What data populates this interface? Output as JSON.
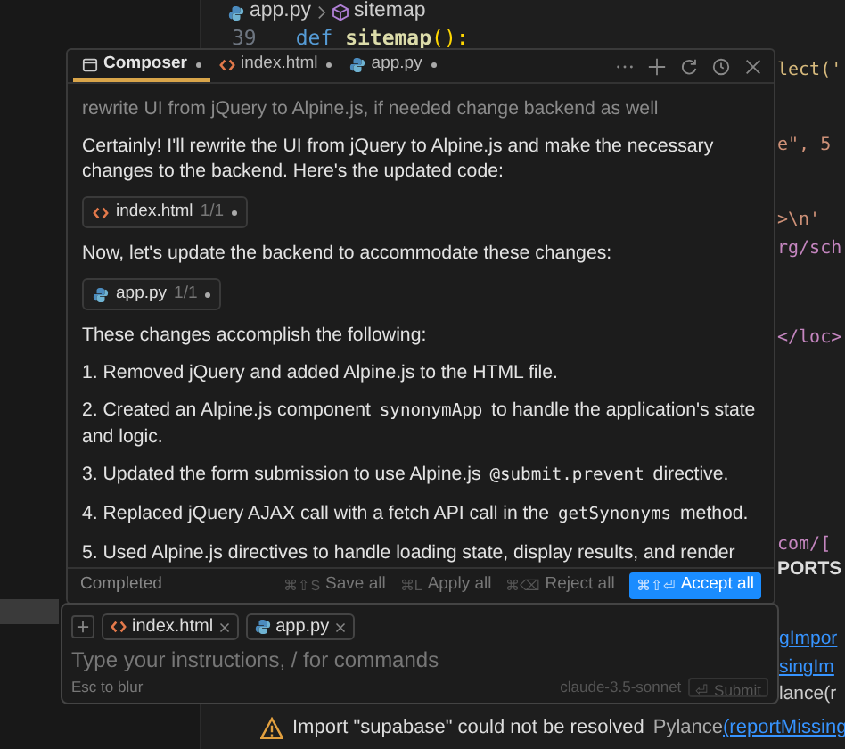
{
  "editor": {
    "breadcrumb": {
      "file": "app.py",
      "symbol": "sitemap"
    },
    "code_line": {
      "line_number": "39",
      "keyword": "def",
      "name": "sitemap",
      "rest": "():"
    },
    "fragments": [
      "lect('",
      "e\", 5",
      ">\\n'",
      "rg/sch",
      "</loc>",
      "com/["
    ]
  },
  "panel": {
    "tab": "PORTS",
    "fragments": [
      "gImpor",
      "singIm",
      "lance(r"
    ],
    "problem": {
      "message": "Import \"supabase\" could not be resolved",
      "source": "Pylance",
      "code": "(reportMissing"
    }
  },
  "composer": {
    "tabs": [
      {
        "label": "Composer",
        "kind": "composer",
        "selected": true
      },
      {
        "label": "index.html",
        "kind": "html",
        "selected": false
      },
      {
        "label": "app.py",
        "kind": "python",
        "selected": false
      }
    ],
    "prompt": "rewrite UI from jQuery to Alpine.js, if needed change backend as well",
    "blocks": [
      {
        "kind": "paragraph",
        "parts": [
          {
            "text": "Certainly! I'll rewrite the UI from jQuery to Alpine.js and make the necessary changes to the backend. Here's the updated code:",
            "code": false
          }
        ]
      },
      {
        "kind": "html_file",
        "name": "index.html",
        "count": "1/1"
      },
      {
        "kind": "paragraph",
        "parts": [
          {
            "text": "Now, let's update the backend to accommodate these changes:",
            "code": false
          }
        ]
      },
      {
        "kind": "python_file",
        "name": "app.py",
        "count": "1/1"
      },
      {
        "kind": "paragraph",
        "parts": [
          {
            "text": "These changes accomplish the following:",
            "code": false
          }
        ]
      },
      {
        "kind": "paragraph",
        "parts": [
          {
            "text": "1. Removed jQuery and added Alpine.js to the HTML file.",
            "code": false
          }
        ]
      },
      {
        "kind": "paragraph",
        "parts": [
          {
            "text": "2. Created an Alpine.js component ",
            "code": false
          },
          {
            "text": "synonymApp",
            "code": true
          },
          {
            "text": " to handle the application's state and logic.",
            "code": false
          }
        ]
      },
      {
        "kind": "paragraph",
        "parts": [
          {
            "text": "3. Updated the form submission to use Alpine.js ",
            "code": false
          },
          {
            "text": "@submit.prevent",
            "code": true
          },
          {
            "text": " directive.",
            "code": false
          }
        ]
      },
      {
        "kind": "paragraph",
        "parts": [
          {
            "text": "4. Replaced jQuery AJAX call with a fetch API call in the ",
            "code": false
          },
          {
            "text": "getSynonyms",
            "code": true
          },
          {
            "text": " method.",
            "code": false
          }
        ]
      },
      {
        "kind": "paragraph",
        "parts": [
          {
            "text": "5. Used Alpine.js directives to handle loading state, display results, and render",
            "code": false
          }
        ]
      }
    ],
    "status": "Completed",
    "actions": [
      {
        "shortcut": "⌘⇧S",
        "label": "Save all",
        "kind": "plain"
      },
      {
        "shortcut": "⌘L",
        "label": "Apply all",
        "kind": "plain"
      },
      {
        "shortcut": "⌘⌫",
        "label": "Reject all",
        "kind": "plain"
      },
      {
        "shortcut": "⌘⇧⏎",
        "label": "Accept all",
        "kind": "primary"
      }
    ]
  },
  "input": {
    "context": [
      {
        "name": "index.html",
        "kind": "html"
      },
      {
        "name": "app.py",
        "kind": "python"
      }
    ],
    "placeholder": "Type your instructions, / for commands",
    "hint": "Esc to blur",
    "model": "claude-3.5-sonnet",
    "submit": {
      "label": "⏎ Submit",
      "disabled": true
    }
  }
}
